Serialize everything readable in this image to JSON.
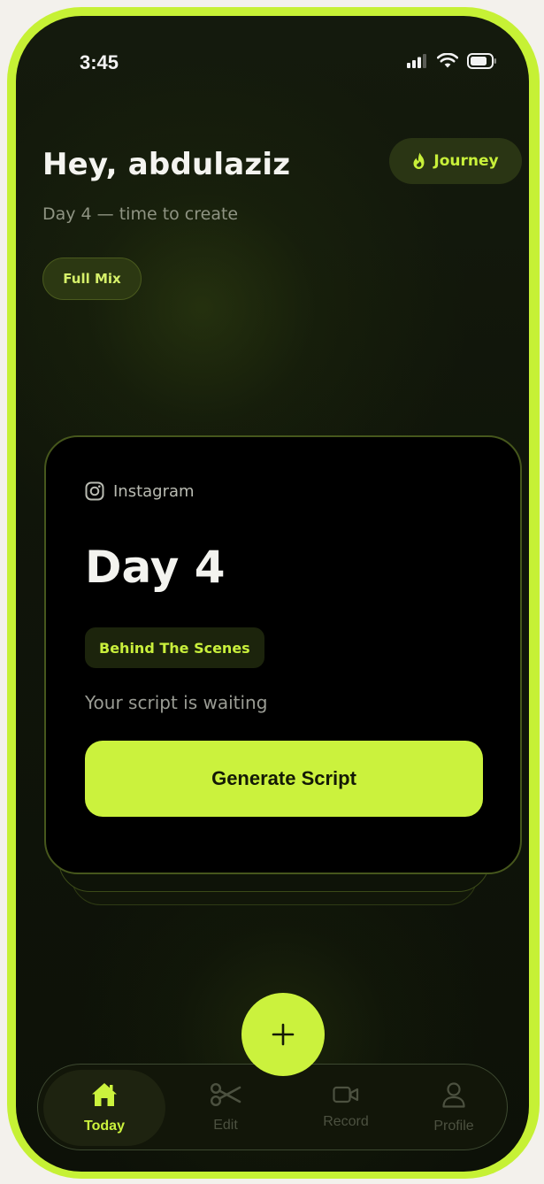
{
  "status": {
    "time": "3:45"
  },
  "header": {
    "greeting": "Hey, abdulaziz",
    "subtitle": "Day 4 — time to create",
    "journey_label": "Journey",
    "mode_chip": "Full Mix"
  },
  "card": {
    "platform": "Instagram",
    "title": "Day 4",
    "category": "Behind The Scenes",
    "status_text": "Your script is waiting",
    "action_label": "Generate Script"
  },
  "nav": {
    "tabs": [
      {
        "label": "Today",
        "icon": "home-icon",
        "active": true
      },
      {
        "label": "Edit",
        "icon": "scissors-icon",
        "active": false
      },
      {
        "label": "Record",
        "icon": "video-camera-icon",
        "active": false
      },
      {
        "label": "Profile",
        "icon": "user-icon",
        "active": false
      }
    ],
    "fab_icon": "plus-icon"
  },
  "colors": {
    "accent": "#cbf23d",
    "background": "#10150a",
    "card": "#000000",
    "frame": "#c6f135"
  }
}
